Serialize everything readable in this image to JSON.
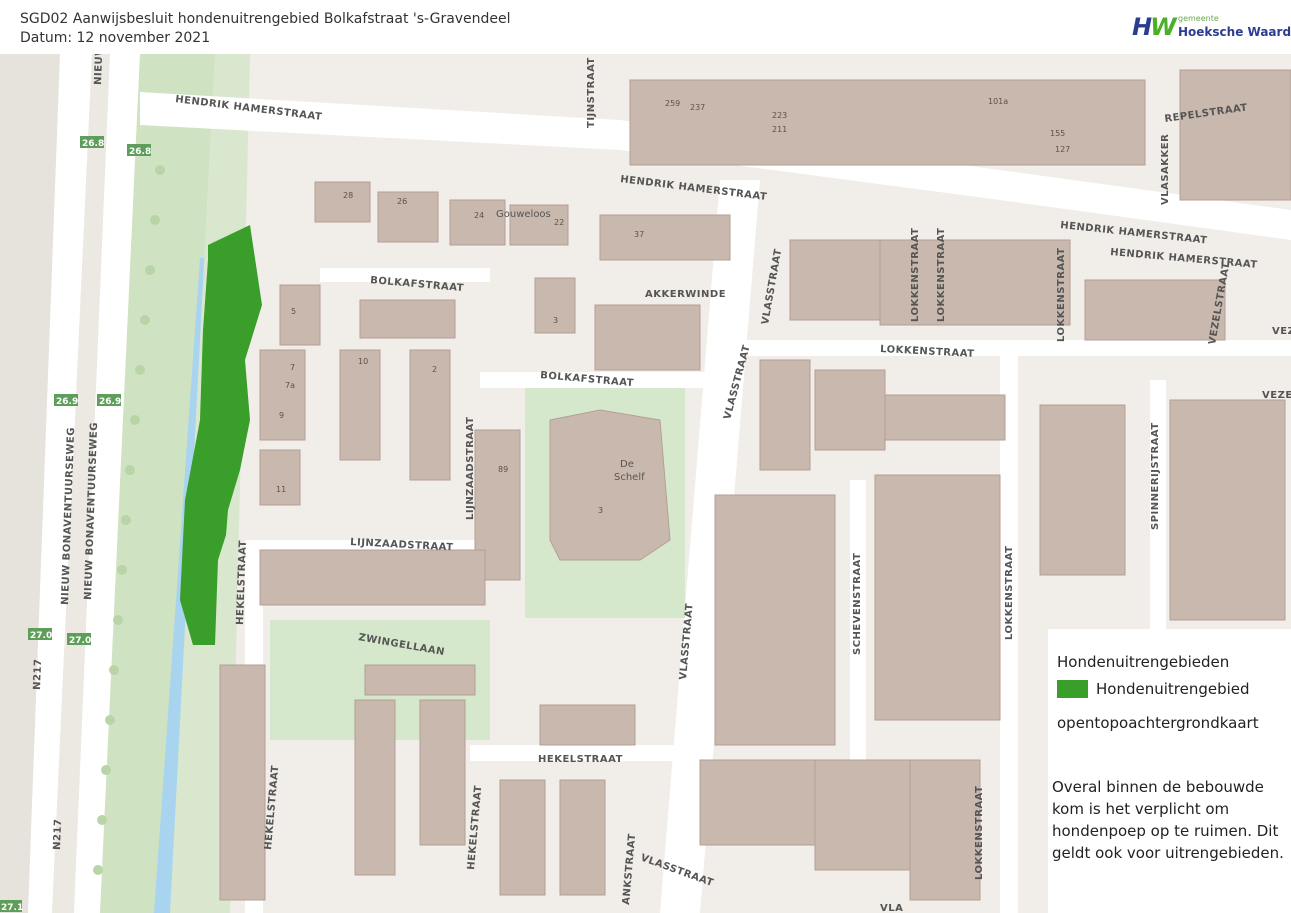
{
  "header": {
    "title": "SGD02 Aanwijsbesluit hondenuitrengebied Bolkafstraat 's-Gravendeel",
    "date": "Datum: 12 november 2021"
  },
  "logo": {
    "mark": "HW",
    "small": "gemeente",
    "name": "Hoeksche Waard"
  },
  "colors": {
    "dog_area": "#3a9e2a",
    "building": "#c9b8ae",
    "road": "#ffffff",
    "sidewalk": "#f2dcd6",
    "grass": "#cfe3c2",
    "water": "#a8d4ef",
    "badge": "#5e9e5a"
  },
  "map": {
    "streets": {
      "hendrik_hamerstraat": "HENDRIK HAMERSTRAAT",
      "tijnstraat": "TIJNSTRAAT",
      "repelstraat": "REPELSTRAAT",
      "vlasakker": "VLASAKKER",
      "bolkafstraat": "BOLKAFSTRAAT",
      "akkerwinde": "AKKERWINDE",
      "vlasstraat": "VLASSTRAAT",
      "lokkenstraat": "LOKKENSTRAAT",
      "vezelstraat": "VEZELSTRAAT",
      "vez": "VEZ",
      "vezel": "VEZEL",
      "lijnzaadstraat": "LIJNZAADSTRAAT",
      "hekelstraat": "HEKELSTRAAT",
      "zwingellaan": "ZWINGELLAAN",
      "schevenstraat": "SCHEVENSTRAAT",
      "spinnerijstraat": "SPINNERIJSTRAAT",
      "nieuw_bonaventuurseweg": "NIEUW BONAVENTUURSEWEG",
      "nieuw": "NIEUW",
      "ankstraat": "ANKSTRAAT",
      "vla": "VLA"
    },
    "route": "N217",
    "poi": {
      "gouweloos": "Gouweloos",
      "de": "De",
      "schelf": "Schelf"
    },
    "badges": [
      "26.8",
      "26.8",
      "26.9",
      "26.9",
      "27.0",
      "27.0",
      "27.1"
    ]
  },
  "legend": {
    "title": "Hondenuitrengebieden",
    "item": "Hondenuitrengebied",
    "basemap": "opentopoachtergrondkaart",
    "note": "Overal binnen de bebouwde kom is het verplicht om hondenpoep op te ruimen. Dit geldt ook voor uitrengebieden."
  }
}
